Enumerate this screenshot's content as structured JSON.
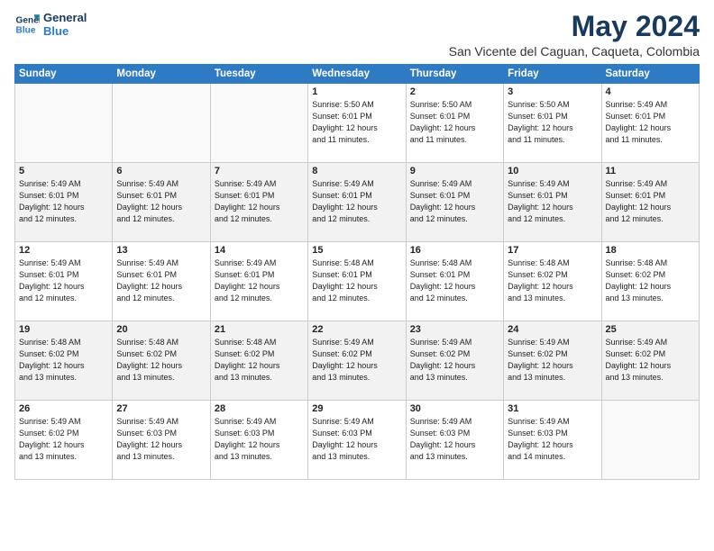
{
  "logo": {
    "line1": "General",
    "line2": "Blue"
  },
  "title": "May 2024",
  "subtitle": "San Vicente del Caguan, Caqueta, Colombia",
  "days_of_week": [
    "Sunday",
    "Monday",
    "Tuesday",
    "Wednesday",
    "Thursday",
    "Friday",
    "Saturday"
  ],
  "weeks": [
    [
      {
        "day": "",
        "info": ""
      },
      {
        "day": "",
        "info": ""
      },
      {
        "day": "",
        "info": ""
      },
      {
        "day": "1",
        "info": "Sunrise: 5:50 AM\nSunset: 6:01 PM\nDaylight: 12 hours\nand 11 minutes."
      },
      {
        "day": "2",
        "info": "Sunrise: 5:50 AM\nSunset: 6:01 PM\nDaylight: 12 hours\nand 11 minutes."
      },
      {
        "day": "3",
        "info": "Sunrise: 5:50 AM\nSunset: 6:01 PM\nDaylight: 12 hours\nand 11 minutes."
      },
      {
        "day": "4",
        "info": "Sunrise: 5:49 AM\nSunset: 6:01 PM\nDaylight: 12 hours\nand 11 minutes."
      }
    ],
    [
      {
        "day": "5",
        "info": "Sunrise: 5:49 AM\nSunset: 6:01 PM\nDaylight: 12 hours\nand 12 minutes."
      },
      {
        "day": "6",
        "info": "Sunrise: 5:49 AM\nSunset: 6:01 PM\nDaylight: 12 hours\nand 12 minutes."
      },
      {
        "day": "7",
        "info": "Sunrise: 5:49 AM\nSunset: 6:01 PM\nDaylight: 12 hours\nand 12 minutes."
      },
      {
        "day": "8",
        "info": "Sunrise: 5:49 AM\nSunset: 6:01 PM\nDaylight: 12 hours\nand 12 minutes."
      },
      {
        "day": "9",
        "info": "Sunrise: 5:49 AM\nSunset: 6:01 PM\nDaylight: 12 hours\nand 12 minutes."
      },
      {
        "day": "10",
        "info": "Sunrise: 5:49 AM\nSunset: 6:01 PM\nDaylight: 12 hours\nand 12 minutes."
      },
      {
        "day": "11",
        "info": "Sunrise: 5:49 AM\nSunset: 6:01 PM\nDaylight: 12 hours\nand 12 minutes."
      }
    ],
    [
      {
        "day": "12",
        "info": "Sunrise: 5:49 AM\nSunset: 6:01 PM\nDaylight: 12 hours\nand 12 minutes."
      },
      {
        "day": "13",
        "info": "Sunrise: 5:49 AM\nSunset: 6:01 PM\nDaylight: 12 hours\nand 12 minutes."
      },
      {
        "day": "14",
        "info": "Sunrise: 5:49 AM\nSunset: 6:01 PM\nDaylight: 12 hours\nand 12 minutes."
      },
      {
        "day": "15",
        "info": "Sunrise: 5:48 AM\nSunset: 6:01 PM\nDaylight: 12 hours\nand 12 minutes."
      },
      {
        "day": "16",
        "info": "Sunrise: 5:48 AM\nSunset: 6:01 PM\nDaylight: 12 hours\nand 12 minutes."
      },
      {
        "day": "17",
        "info": "Sunrise: 5:48 AM\nSunset: 6:02 PM\nDaylight: 12 hours\nand 13 minutes."
      },
      {
        "day": "18",
        "info": "Sunrise: 5:48 AM\nSunset: 6:02 PM\nDaylight: 12 hours\nand 13 minutes."
      }
    ],
    [
      {
        "day": "19",
        "info": "Sunrise: 5:48 AM\nSunset: 6:02 PM\nDaylight: 12 hours\nand 13 minutes."
      },
      {
        "day": "20",
        "info": "Sunrise: 5:48 AM\nSunset: 6:02 PM\nDaylight: 12 hours\nand 13 minutes."
      },
      {
        "day": "21",
        "info": "Sunrise: 5:48 AM\nSunset: 6:02 PM\nDaylight: 12 hours\nand 13 minutes."
      },
      {
        "day": "22",
        "info": "Sunrise: 5:49 AM\nSunset: 6:02 PM\nDaylight: 12 hours\nand 13 minutes."
      },
      {
        "day": "23",
        "info": "Sunrise: 5:49 AM\nSunset: 6:02 PM\nDaylight: 12 hours\nand 13 minutes."
      },
      {
        "day": "24",
        "info": "Sunrise: 5:49 AM\nSunset: 6:02 PM\nDaylight: 12 hours\nand 13 minutes."
      },
      {
        "day": "25",
        "info": "Sunrise: 5:49 AM\nSunset: 6:02 PM\nDaylight: 12 hours\nand 13 minutes."
      }
    ],
    [
      {
        "day": "26",
        "info": "Sunrise: 5:49 AM\nSunset: 6:02 PM\nDaylight: 12 hours\nand 13 minutes."
      },
      {
        "day": "27",
        "info": "Sunrise: 5:49 AM\nSunset: 6:03 PM\nDaylight: 12 hours\nand 13 minutes."
      },
      {
        "day": "28",
        "info": "Sunrise: 5:49 AM\nSunset: 6:03 PM\nDaylight: 12 hours\nand 13 minutes."
      },
      {
        "day": "29",
        "info": "Sunrise: 5:49 AM\nSunset: 6:03 PM\nDaylight: 12 hours\nand 13 minutes."
      },
      {
        "day": "30",
        "info": "Sunrise: 5:49 AM\nSunset: 6:03 PM\nDaylight: 12 hours\nand 13 minutes."
      },
      {
        "day": "31",
        "info": "Sunrise: 5:49 AM\nSunset: 6:03 PM\nDaylight: 12 hours\nand 14 minutes."
      },
      {
        "day": "",
        "info": ""
      }
    ]
  ]
}
